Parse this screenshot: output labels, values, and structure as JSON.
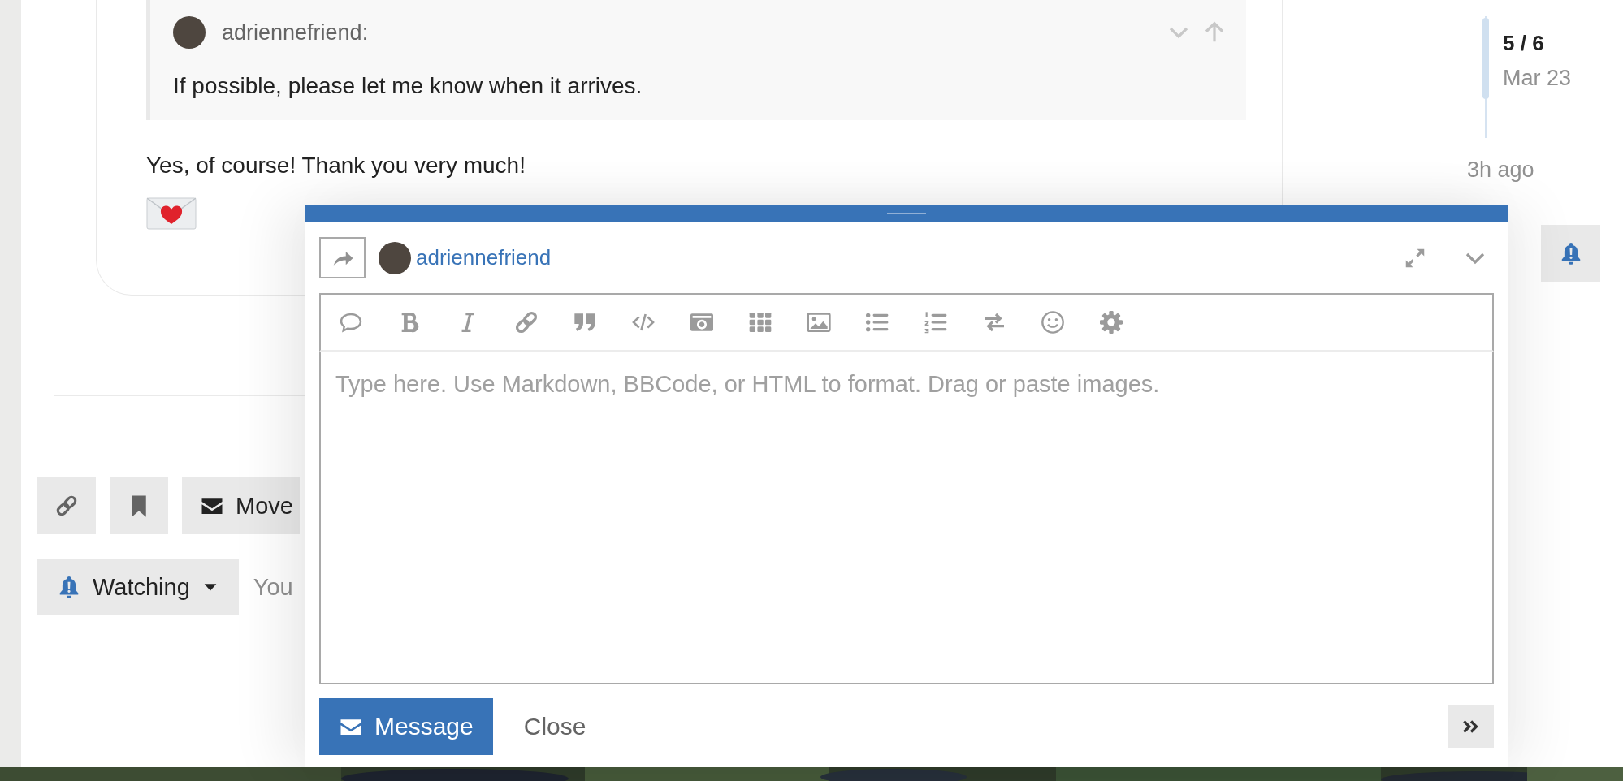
{
  "post": {
    "quote": {
      "author": "adriennefriend:",
      "text": "If possible, please let me know when it arrives."
    },
    "body": "Yes, of course! Thank you very much!"
  },
  "topic_footer": {
    "move_label": "Move",
    "notification_level": "Watching",
    "notification_description": "You"
  },
  "timeline": {
    "position": "5 / 6",
    "date": "Mar 23",
    "last_activity": "3h ago"
  },
  "composer": {
    "recipient": "adriennefriend",
    "placeholder": "Type here. Use Markdown, BBCode, or HTML to format. Drag or paste images.",
    "submit_label": "Message",
    "cancel_label": "Close"
  }
}
